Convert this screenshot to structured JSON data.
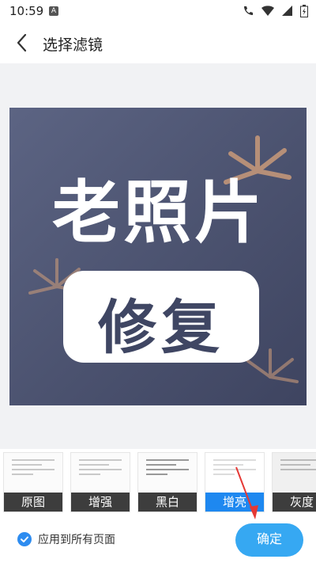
{
  "status_bar": {
    "time": "10:59",
    "notif_letter": "A",
    "icons": [
      "call-icon",
      "wifi-icon",
      "signal-icon",
      "battery-icon"
    ]
  },
  "header": {
    "title": "选择滤镜",
    "back_icon": "chevron-left-icon"
  },
  "preview": {
    "main_text": "老照片",
    "badge_text": "修复",
    "bg_color": "#4d5472"
  },
  "filters": {
    "items": [
      {
        "label": "原图",
        "selected": false
      },
      {
        "label": "增强",
        "selected": false
      },
      {
        "label": "黑白",
        "selected": false
      },
      {
        "label": "增亮",
        "selected": true
      },
      {
        "label": "灰度",
        "selected": false
      }
    ],
    "selected_color": "#1e88f0"
  },
  "bottom": {
    "apply_all_label": "应用到所有页面",
    "apply_all_checked": true,
    "confirm_label": "确定",
    "accent": "#36a8f2"
  }
}
